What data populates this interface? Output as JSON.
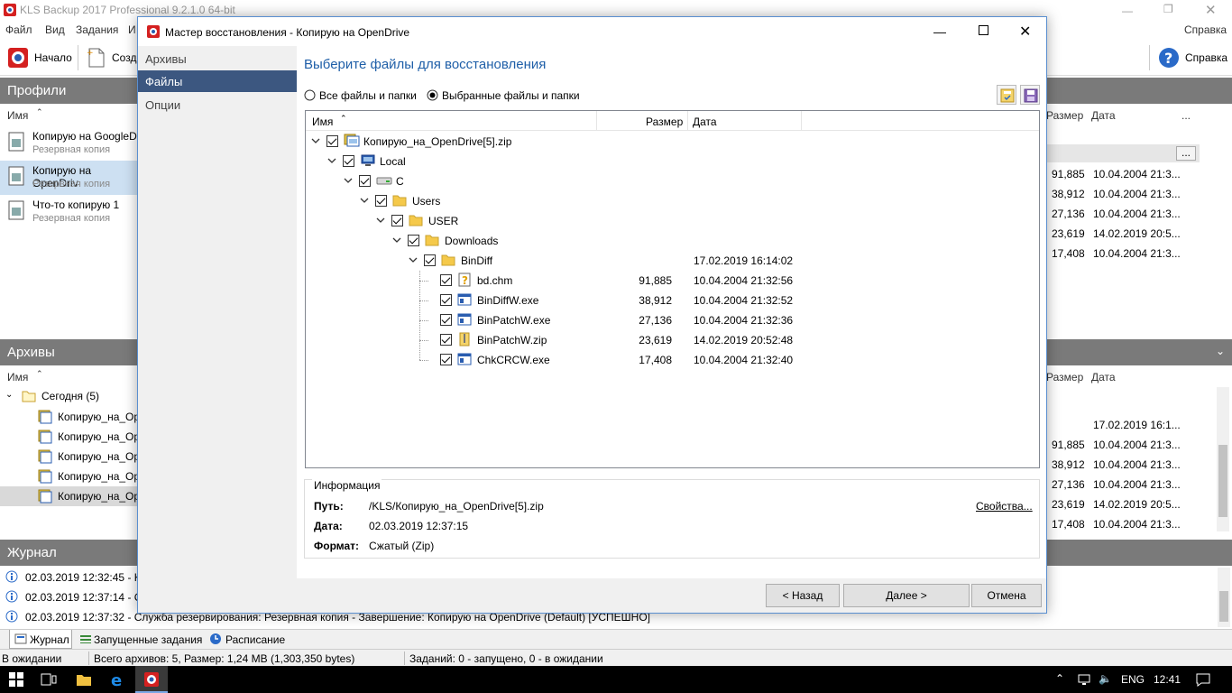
{
  "app": {
    "title": "KLS Backup 2017 Professional 9.2.1.0 64-bit",
    "menu": [
      "Файл",
      "Вид",
      "Задания",
      "И"
    ],
    "menu_right": "Справка",
    "toolbar": {
      "home": "Начало",
      "create": "Созда",
      "help": "Справка"
    },
    "profiles": {
      "header": "Профили",
      "col_name": "Имя",
      "col_size": "Размер",
      "col_date": "Дата",
      "more": "...",
      "items": [
        {
          "name": "Копирую на GoogleD",
          "sub": "Резервная копия"
        },
        {
          "name": "Копирую на OpenDriv",
          "sub": "Резервная копия"
        },
        {
          "name": "Что-то копирую 1",
          "sub": "Резервная копия"
        }
      ],
      "rows": [
        {
          "size": "91,885",
          "date": "10.04.2004 21:3..."
        },
        {
          "size": "38,912",
          "date": "10.04.2004 21:3..."
        },
        {
          "size": "27,136",
          "date": "10.04.2004 21:3..."
        },
        {
          "size": "23,619",
          "date": "14.02.2019 20:5..."
        },
        {
          "size": "17,408",
          "date": "10.04.2004 21:3..."
        }
      ]
    },
    "archives": {
      "header": "Архивы",
      "col_name": "Имя",
      "col_size": "Размер",
      "col_date": "Дата",
      "today": "Сегодня (5)",
      "items": [
        "Копирую_на_Op",
        "Копирую_на_Op",
        "Копирую_на_Op",
        "Копирую_на_Op",
        "Копирую_на_Op"
      ],
      "rows": [
        {
          "size": "",
          "date": "17.02.2019 16:1..."
        },
        {
          "size": "91,885",
          "date": "10.04.2004 21:3..."
        },
        {
          "size": "38,912",
          "date": "10.04.2004 21:3..."
        },
        {
          "size": "27,136",
          "date": "10.04.2004 21:3..."
        },
        {
          "size": "23,619",
          "date": "14.02.2019 20:5..."
        },
        {
          "size": "17,408",
          "date": "10.04.2004 21:3..."
        }
      ]
    },
    "journal": {
      "header": "Журнал",
      "entries": [
        "02.03.2019 12:32:45 - KLS",
        "02.03.2019 12:37:14 - Слу",
        "02.03.2019 12:37:32 - Служба резервирования: Резервная копия - Завершение: Копирую на OpenDrive (Default) [УСПЕШНО]"
      ]
    },
    "tabs": [
      "Журнал",
      "Запущенные задания",
      "Расписание"
    ],
    "status": {
      "state": "В ожидании",
      "archives": "Всего архивов: 5, Размер: 1,24 MB (1,303,350 bytes)",
      "tasks": "Заданий: 0 - запущено, 0 - в ожидании"
    }
  },
  "dialog": {
    "title": "Мастер восстановления - Копирую на OpenDrive",
    "sidebar": [
      "Архивы",
      "Файлы",
      "Опции"
    ],
    "heading": "Выберите файлы для восстановления",
    "radio_all": "Все файлы и папки",
    "radio_selected": "Выбранные файлы и папки",
    "columns": {
      "name": "Имя",
      "size": "Размер",
      "date": "Дата"
    },
    "tree": [
      {
        "name": "Копирую_на_OpenDrive[5].zip",
        "size": "",
        "date": "",
        "level": 0,
        "icon": "archive-icon",
        "expand": true
      },
      {
        "name": "Local",
        "size": "",
        "date": "",
        "level": 1,
        "icon": "computer-icon",
        "expand": true
      },
      {
        "name": "C",
        "size": "",
        "date": "",
        "level": 2,
        "icon": "drive-icon",
        "expand": true
      },
      {
        "name": "Users",
        "size": "",
        "date": "",
        "level": 3,
        "icon": "folder-icon",
        "expand": true
      },
      {
        "name": "USER",
        "size": "",
        "date": "",
        "level": 4,
        "icon": "folder-icon",
        "expand": true
      },
      {
        "name": "Downloads",
        "size": "",
        "date": "",
        "level": 5,
        "icon": "folder-icon",
        "expand": true
      },
      {
        "name": "BinDiff",
        "size": "",
        "date": "17.02.2019 16:14:02",
        "level": 6,
        "icon": "folder-icon",
        "expand": true
      },
      {
        "name": "bd.chm",
        "size": "91,885",
        "date": "10.04.2004 21:32:56",
        "level": 7,
        "icon": "help-file-icon",
        "expand": false
      },
      {
        "name": "BinDiffW.exe",
        "size": "38,912",
        "date": "10.04.2004 21:32:52",
        "level": 7,
        "icon": "exe-icon",
        "expand": false
      },
      {
        "name": "BinPatchW.exe",
        "size": "27,136",
        "date": "10.04.2004 21:32:36",
        "level": 7,
        "icon": "exe-icon",
        "expand": false
      },
      {
        "name": "BinPatchW.zip",
        "size": "23,619",
        "date": "14.02.2019 20:52:48",
        "level": 7,
        "icon": "zip-icon",
        "expand": false
      },
      {
        "name": "ChkCRCW.exe",
        "size": "17,408",
        "date": "10.04.2004 21:32:40",
        "level": 7,
        "icon": "exe-icon",
        "expand": false
      }
    ],
    "info": {
      "title": "Информация",
      "path_label": "Путь:",
      "path": "/KLS/Копирую_на_OpenDrive[5].zip",
      "properties": "Свойства...",
      "date_label": "Дата:",
      "date": "02.03.2019 12:37:15",
      "format_label": "Формат:",
      "format": "Сжатый (Zip)"
    },
    "buttons": {
      "back": "< Назад",
      "next": "Далее >",
      "cancel": "Отмена"
    }
  },
  "taskbar": {
    "lang": "ENG",
    "time": "12:41"
  }
}
